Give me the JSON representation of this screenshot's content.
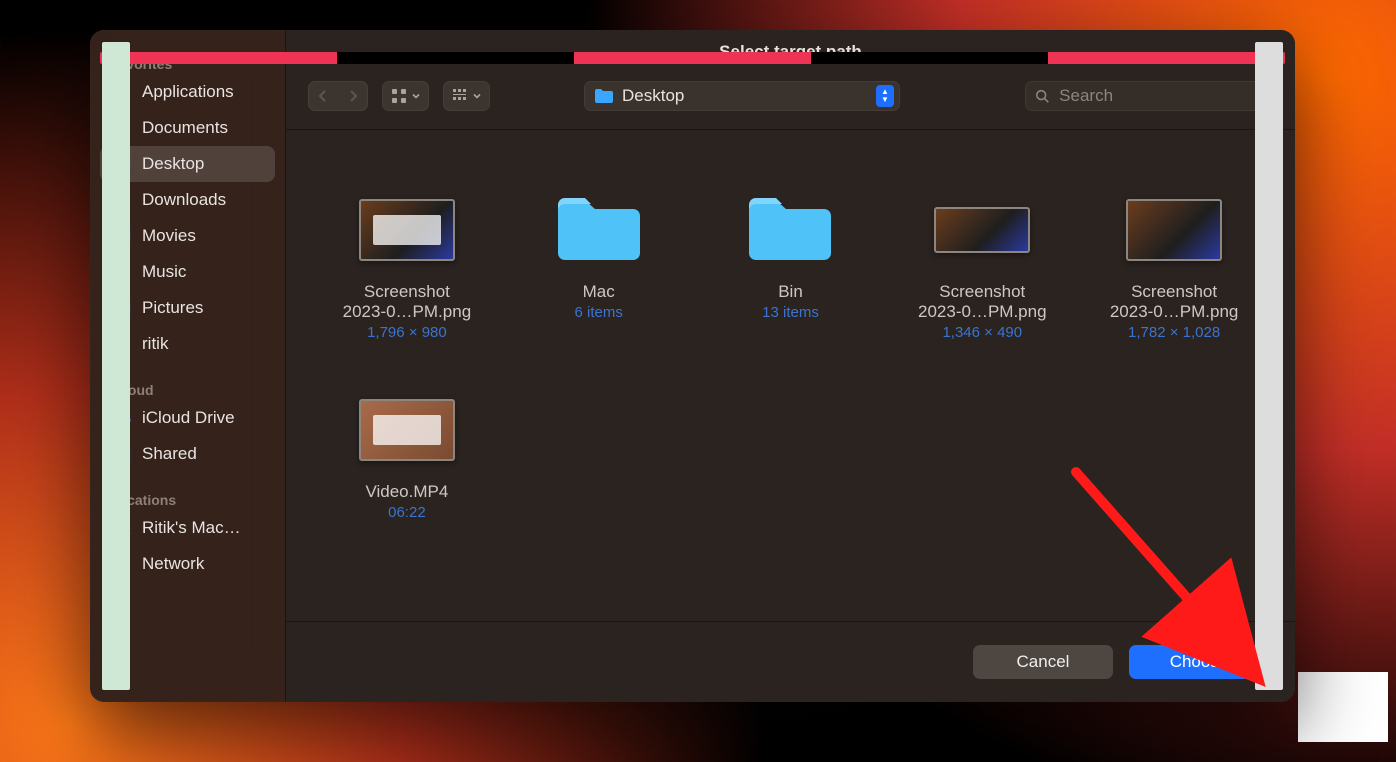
{
  "dialog": {
    "title": "Select target path"
  },
  "sidebar": {
    "sections": {
      "favorites_label": "Favorites",
      "icloud_label": "iCloud",
      "locations_label": "Locations"
    },
    "favorites": [
      {
        "label": "Applications",
        "icon": "applications-icon"
      },
      {
        "label": "Documents",
        "icon": "documents-icon"
      },
      {
        "label": "Desktop",
        "icon": "desktop-icon",
        "selected": true
      },
      {
        "label": "Downloads",
        "icon": "downloads-icon"
      },
      {
        "label": "Movies",
        "icon": "movies-icon"
      },
      {
        "label": "Music",
        "icon": "music-icon"
      },
      {
        "label": "Pictures",
        "icon": "pictures-icon"
      },
      {
        "label": "ritik",
        "icon": "home-icon"
      }
    ],
    "icloud": [
      {
        "label": "iCloud Drive",
        "icon": "cloud-icon"
      },
      {
        "label": "Shared",
        "icon": "shared-folder-icon"
      }
    ],
    "locations": [
      {
        "label": "Ritik's Mac…",
        "icon": "laptop-icon"
      },
      {
        "label": "Network",
        "icon": "globe-icon"
      }
    ]
  },
  "toolbar": {
    "path_name": "Desktop",
    "search_placeholder": "Search"
  },
  "items": [
    {
      "type": "image",
      "name1": "Screenshot",
      "name2": "2023-0…PM.png",
      "meta": "1,796 × 980"
    },
    {
      "type": "folder",
      "name1": "Mac",
      "name2": "",
      "meta": "6 items"
    },
    {
      "type": "folder",
      "name1": "Bin",
      "name2": "",
      "meta": "13 items"
    },
    {
      "type": "image",
      "name1": "Screenshot",
      "name2": "2023-0…PM.png",
      "meta": "1,346 × 490",
      "variant": "strip"
    },
    {
      "type": "image",
      "name1": "Screenshot",
      "name2": "2023-0…PM.png",
      "meta": "1,782 × 1,028",
      "variant": "twowin"
    },
    {
      "type": "video",
      "name1": "Video.MP4",
      "name2": "",
      "meta": "06:22"
    }
  ],
  "buttons": {
    "cancel": "Cancel",
    "choose": "Choose"
  }
}
